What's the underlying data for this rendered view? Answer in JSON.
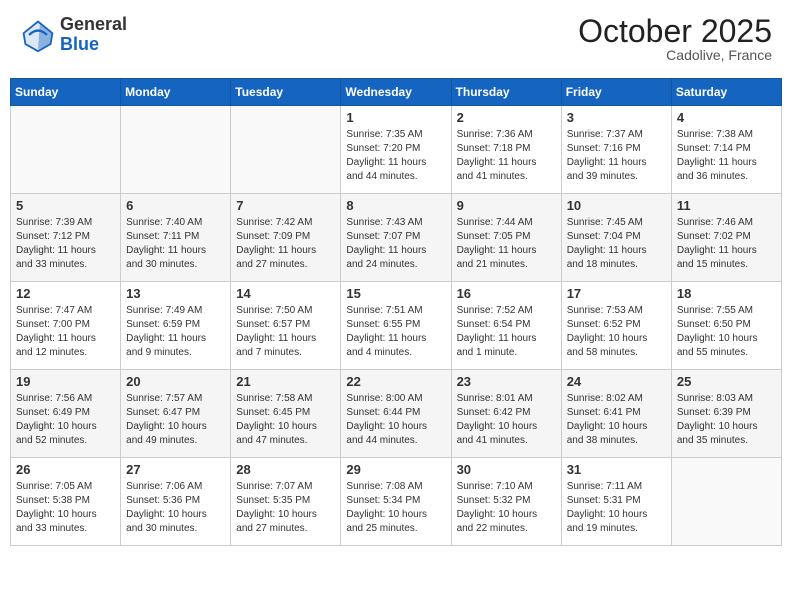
{
  "header": {
    "logo_general": "General",
    "logo_blue": "Blue",
    "month": "October 2025",
    "location": "Cadolive, France"
  },
  "weekdays": [
    "Sunday",
    "Monday",
    "Tuesday",
    "Wednesday",
    "Thursday",
    "Friday",
    "Saturday"
  ],
  "weeks": [
    [
      {
        "day": "",
        "empty": true
      },
      {
        "day": "",
        "empty": true
      },
      {
        "day": "",
        "empty": true
      },
      {
        "day": "1",
        "sunrise": "Sunrise: 7:35 AM",
        "sunset": "Sunset: 7:20 PM",
        "daylight": "Daylight: 11 hours and 44 minutes."
      },
      {
        "day": "2",
        "sunrise": "Sunrise: 7:36 AM",
        "sunset": "Sunset: 7:18 PM",
        "daylight": "Daylight: 11 hours and 41 minutes."
      },
      {
        "day": "3",
        "sunrise": "Sunrise: 7:37 AM",
        "sunset": "Sunset: 7:16 PM",
        "daylight": "Daylight: 11 hours and 39 minutes."
      },
      {
        "day": "4",
        "sunrise": "Sunrise: 7:38 AM",
        "sunset": "Sunset: 7:14 PM",
        "daylight": "Daylight: 11 hours and 36 minutes."
      }
    ],
    [
      {
        "day": "5",
        "sunrise": "Sunrise: 7:39 AM",
        "sunset": "Sunset: 7:12 PM",
        "daylight": "Daylight: 11 hours and 33 minutes."
      },
      {
        "day": "6",
        "sunrise": "Sunrise: 7:40 AM",
        "sunset": "Sunset: 7:11 PM",
        "daylight": "Daylight: 11 hours and 30 minutes."
      },
      {
        "day": "7",
        "sunrise": "Sunrise: 7:42 AM",
        "sunset": "Sunset: 7:09 PM",
        "daylight": "Daylight: 11 hours and 27 minutes."
      },
      {
        "day": "8",
        "sunrise": "Sunrise: 7:43 AM",
        "sunset": "Sunset: 7:07 PM",
        "daylight": "Daylight: 11 hours and 24 minutes."
      },
      {
        "day": "9",
        "sunrise": "Sunrise: 7:44 AM",
        "sunset": "Sunset: 7:05 PM",
        "daylight": "Daylight: 11 hours and 21 minutes."
      },
      {
        "day": "10",
        "sunrise": "Sunrise: 7:45 AM",
        "sunset": "Sunset: 7:04 PM",
        "daylight": "Daylight: 11 hours and 18 minutes."
      },
      {
        "day": "11",
        "sunrise": "Sunrise: 7:46 AM",
        "sunset": "Sunset: 7:02 PM",
        "daylight": "Daylight: 11 hours and 15 minutes."
      }
    ],
    [
      {
        "day": "12",
        "sunrise": "Sunrise: 7:47 AM",
        "sunset": "Sunset: 7:00 PM",
        "daylight": "Daylight: 11 hours and 12 minutes."
      },
      {
        "day": "13",
        "sunrise": "Sunrise: 7:49 AM",
        "sunset": "Sunset: 6:59 PM",
        "daylight": "Daylight: 11 hours and 9 minutes."
      },
      {
        "day": "14",
        "sunrise": "Sunrise: 7:50 AM",
        "sunset": "Sunset: 6:57 PM",
        "daylight": "Daylight: 11 hours and 7 minutes."
      },
      {
        "day": "15",
        "sunrise": "Sunrise: 7:51 AM",
        "sunset": "Sunset: 6:55 PM",
        "daylight": "Daylight: 11 hours and 4 minutes."
      },
      {
        "day": "16",
        "sunrise": "Sunrise: 7:52 AM",
        "sunset": "Sunset: 6:54 PM",
        "daylight": "Daylight: 11 hours and 1 minute."
      },
      {
        "day": "17",
        "sunrise": "Sunrise: 7:53 AM",
        "sunset": "Sunset: 6:52 PM",
        "daylight": "Daylight: 10 hours and 58 minutes."
      },
      {
        "day": "18",
        "sunrise": "Sunrise: 7:55 AM",
        "sunset": "Sunset: 6:50 PM",
        "daylight": "Daylight: 10 hours and 55 minutes."
      }
    ],
    [
      {
        "day": "19",
        "sunrise": "Sunrise: 7:56 AM",
        "sunset": "Sunset: 6:49 PM",
        "daylight": "Daylight: 10 hours and 52 minutes."
      },
      {
        "day": "20",
        "sunrise": "Sunrise: 7:57 AM",
        "sunset": "Sunset: 6:47 PM",
        "daylight": "Daylight: 10 hours and 49 minutes."
      },
      {
        "day": "21",
        "sunrise": "Sunrise: 7:58 AM",
        "sunset": "Sunset: 6:45 PM",
        "daylight": "Daylight: 10 hours and 47 minutes."
      },
      {
        "day": "22",
        "sunrise": "Sunrise: 8:00 AM",
        "sunset": "Sunset: 6:44 PM",
        "daylight": "Daylight: 10 hours and 44 minutes."
      },
      {
        "day": "23",
        "sunrise": "Sunrise: 8:01 AM",
        "sunset": "Sunset: 6:42 PM",
        "daylight": "Daylight: 10 hours and 41 minutes."
      },
      {
        "day": "24",
        "sunrise": "Sunrise: 8:02 AM",
        "sunset": "Sunset: 6:41 PM",
        "daylight": "Daylight: 10 hours and 38 minutes."
      },
      {
        "day": "25",
        "sunrise": "Sunrise: 8:03 AM",
        "sunset": "Sunset: 6:39 PM",
        "daylight": "Daylight: 10 hours and 35 minutes."
      }
    ],
    [
      {
        "day": "26",
        "sunrise": "Sunrise: 7:05 AM",
        "sunset": "Sunset: 5:38 PM",
        "daylight": "Daylight: 10 hours and 33 minutes."
      },
      {
        "day": "27",
        "sunrise": "Sunrise: 7:06 AM",
        "sunset": "Sunset: 5:36 PM",
        "daylight": "Daylight: 10 hours and 30 minutes."
      },
      {
        "day": "28",
        "sunrise": "Sunrise: 7:07 AM",
        "sunset": "Sunset: 5:35 PM",
        "daylight": "Daylight: 10 hours and 27 minutes."
      },
      {
        "day": "29",
        "sunrise": "Sunrise: 7:08 AM",
        "sunset": "Sunset: 5:34 PM",
        "daylight": "Daylight: 10 hours and 25 minutes."
      },
      {
        "day": "30",
        "sunrise": "Sunrise: 7:10 AM",
        "sunset": "Sunset: 5:32 PM",
        "daylight": "Daylight: 10 hours and 22 minutes."
      },
      {
        "day": "31",
        "sunrise": "Sunrise: 7:11 AM",
        "sunset": "Sunset: 5:31 PM",
        "daylight": "Daylight: 10 hours and 19 minutes."
      },
      {
        "day": "",
        "empty": true
      }
    ]
  ]
}
